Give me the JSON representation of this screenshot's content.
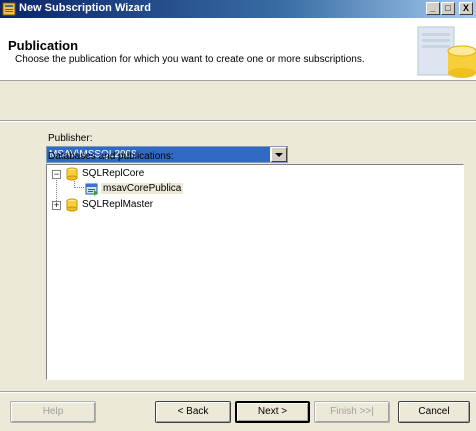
{
  "window": {
    "title": "New Subscription Wizard",
    "controls": {
      "minimize": "_",
      "maximize": "□",
      "close": "X"
    }
  },
  "header": {
    "title": "Publication",
    "subtitle": "Choose the publication for which you want to create one or more subscriptions.",
    "graphic_icon": "database-cylinder-graphic"
  },
  "form": {
    "publisher_label": "Publisher:",
    "publisher_value": "MSAV\\MSSQL2008",
    "databases_label": "Databases and publications:",
    "tree": [
      {
        "label": "SQLReplCore",
        "icon": "database-icon",
        "expanded": true,
        "children": [
          {
            "label": "msavCorePublica",
            "icon": "publication-icon",
            "selected": true
          }
        ]
      },
      {
        "label": "SQLReplMaster",
        "icon": "database-icon",
        "expanded": false,
        "children": []
      }
    ]
  },
  "buttons": {
    "help": "Help",
    "back": "< Back",
    "next": "Next >",
    "finish": "Finish >>|",
    "cancel": "Cancel"
  },
  "colors": {
    "titlebar_start": "#0a246a",
    "titlebar_end": "#a6caf0",
    "selection": "#316ac5",
    "dialog_bg": "#ece9d8"
  }
}
